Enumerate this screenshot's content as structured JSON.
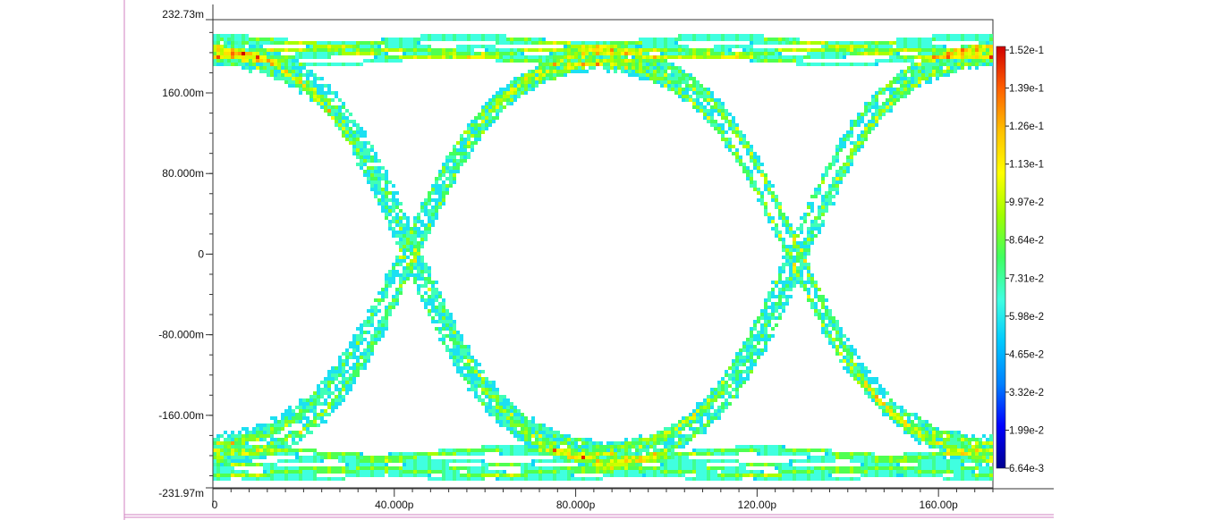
{
  "chart_data": {
    "type": "heatmap",
    "title": "",
    "xlabel": "",
    "ylabel": "",
    "x_unit": "s",
    "y_unit": "V",
    "xlim": [
      0,
      172
    ],
    "ylim": [
      -231.97,
      232.73
    ],
    "x_ticks": [
      {
        "value": 0,
        "label": "0"
      },
      {
        "value": 40,
        "label": "40.000p"
      },
      {
        "value": 80,
        "label": "80.000p"
      },
      {
        "value": 120,
        "label": "120.00p"
      },
      {
        "value": 160,
        "label": "160.00p"
      }
    ],
    "y_ticks": [
      {
        "value": 232.73,
        "label": "232.73m"
      },
      {
        "value": 160,
        "label": "160.00m"
      },
      {
        "value": 80,
        "label": "80.000m"
      },
      {
        "value": 0,
        "label": "0"
      },
      {
        "value": -80,
        "label": "-80.000m"
      },
      {
        "value": -160,
        "label": "-160.00m"
      },
      {
        "value": -231.97,
        "label": "-231.97m"
      }
    ],
    "eye": {
      "high_level_mV": 205,
      "low_level_mV": -205,
      "crossings_ps": [
        43.5,
        128.5
      ],
      "bit_period_ps": 85
    },
    "colorbar": {
      "min": 0.00664,
      "max": 0.152,
      "labels": [
        "1.52e-1",
        "1.39e-1",
        "1.26e-1",
        "1.13e-1",
        "9.97e-2",
        "8.64e-2",
        "7.31e-2",
        "5.98e-2",
        "4.65e-2",
        "3.32e-2",
        "1.99e-2",
        "6.64e-3"
      ],
      "colors": [
        "#00008f",
        "#0000ff",
        "#0080ff",
        "#00c8ff",
        "#40ffe0",
        "#40ff60",
        "#a0ff00",
        "#ffff00",
        "#ffc000",
        "#ff6000",
        "#d00000"
      ]
    },
    "grid": false,
    "legend": "colorbar-right"
  }
}
